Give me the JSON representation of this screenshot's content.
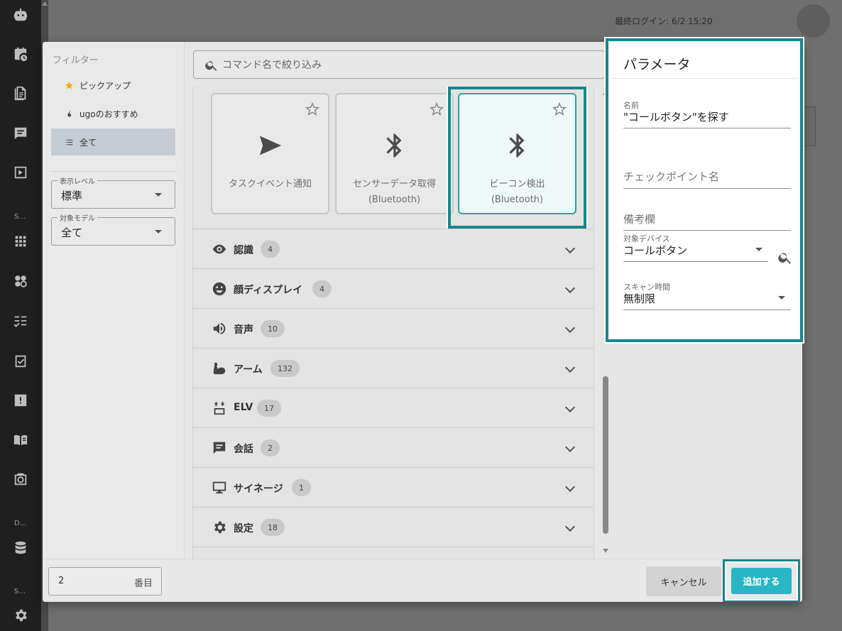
{
  "topbar": {
    "last_login": "最終ログイン: 6/2 15:20"
  },
  "rail": {
    "groups": [
      "S...",
      "D...",
      "S..."
    ],
    "icons": [
      "robot-icon",
      "schedule-icon",
      "document-icon",
      "chat-icon",
      "play-icon",
      "grid-icon",
      "flower-icon",
      "checklist-icon",
      "task-icon",
      "alert-icon",
      "book-icon",
      "camera-icon",
      "database-icon",
      "settings-icon"
    ]
  },
  "filter": {
    "title": "フィルター",
    "items": [
      {
        "label": "ピックアップ",
        "icon": "star-icon"
      },
      {
        "label": "ugoのおすすめ",
        "icon": "fire-icon"
      },
      {
        "label": "全て",
        "icon": "list-icon",
        "active": true
      }
    ],
    "display_level": {
      "label": "表示レベル",
      "value": "標準"
    },
    "target_model": {
      "label": "対象モデル",
      "value": "全て"
    }
  },
  "search": {
    "placeholder": "コマンド名で絞り込み"
  },
  "cards": [
    {
      "label": "タスクイベント通知",
      "icon": "send-icon"
    },
    {
      "label": "センサーデータ取得",
      "sub": "(Bluetooth)",
      "icon": "bluetooth-icon"
    },
    {
      "label": "ビーコン検出",
      "sub": "(Bluetooth)",
      "icon": "bluetooth-icon",
      "selected": true
    }
  ],
  "categories": [
    {
      "name": "認識",
      "count": "4",
      "icon": "eye-icon"
    },
    {
      "name": "顔ディスプレイ",
      "count": "4",
      "icon": "face-icon"
    },
    {
      "name": "音声",
      "count": "10",
      "icon": "speaker-icon"
    },
    {
      "name": "アーム",
      "count": "132",
      "icon": "arm-icon"
    },
    {
      "name": "ELV",
      "count": "17",
      "icon": "elevator-icon"
    },
    {
      "name": "会話",
      "count": "2",
      "icon": "message-icon"
    },
    {
      "name": "サイネージ",
      "count": "1",
      "icon": "monitor-icon"
    },
    {
      "name": "設定",
      "count": "18",
      "icon": "gear-icon"
    }
  ],
  "params": {
    "title": "パラメータ",
    "name": {
      "label": "名前",
      "value": "\"コールボタン\"を探す"
    },
    "checkpoint": {
      "placeholder": "チェックポイント名"
    },
    "remarks": {
      "placeholder": "備考欄"
    },
    "target_device": {
      "label": "対象デバイス",
      "value": "コールボタン"
    },
    "scan_time": {
      "label": "スキャン時間",
      "value": "無制限"
    }
  },
  "footer": {
    "order_value": "2",
    "order_unit": "番目",
    "cancel_label": "キャンセル",
    "add_label": "追加する"
  },
  "colors": {
    "accent": "#28b6c4",
    "highlight": "#17878b"
  }
}
